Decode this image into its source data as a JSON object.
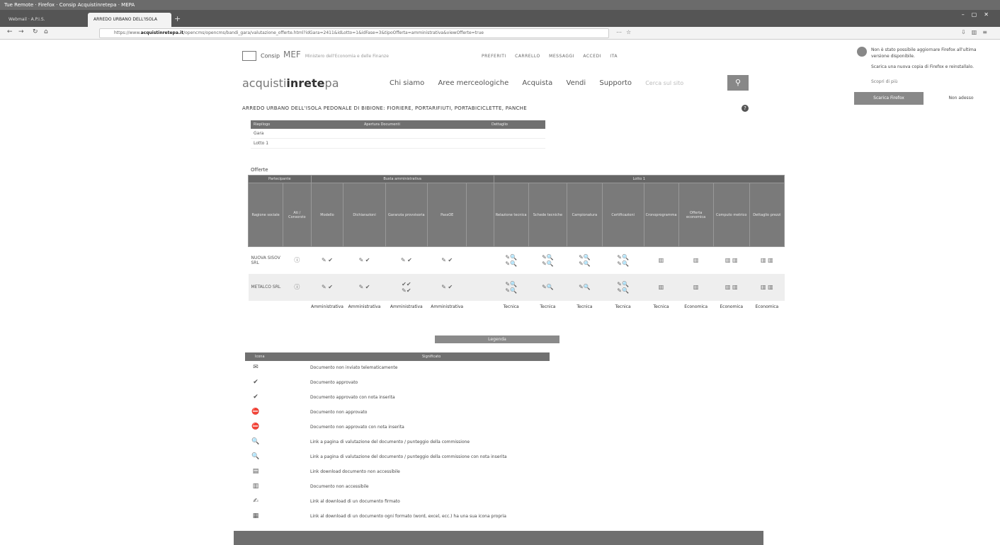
{
  "browser": {
    "window_title": "Tue Remote · Firefox · Consip Acquistinretepa · MEPA",
    "tabs": [
      {
        "label": "Webmail · A.P.I.S."
      },
      {
        "label": "ARREDO URBANO DELL'ISOLA P"
      }
    ],
    "url_prefix": "https://www.",
    "url_domain": "acquistinretepa.it",
    "url_rest": "/opencms/opencms/bandi_gara/valutazione_offerte.html?idGara=2411&idLotto=1&idFase=3&tipoOfferta=amministrativa&viewOfferte=true",
    "tab_close": "×",
    "new_tab": "+"
  },
  "header": {
    "consip": "Consip",
    "mef": "MEF",
    "mef_sub": "Ministero dell'Economia e delle Finanze",
    "top_links": [
      "PREFERITI",
      "CARRELLO",
      "MESSAGGI",
      "ACCEDI",
      "ITA"
    ],
    "brand_light": "acquisti",
    "brand_bold": "inrete",
    "brand_end": "pa",
    "nav": [
      "Chi siamo",
      "Aree merceologiche",
      "Acquista",
      "Vendi",
      "Supporto"
    ],
    "search_placeholder": "Cerca sul sito",
    "help": "?"
  },
  "page_title": "ARREDO URBANO DELL'ISOLA PEDONALE DI BIBIONE: FIORIERE, PORTARIFIUTI, PORTABICICLETTE, PANCHE",
  "lot_table": {
    "headers": [
      "Riepilogo",
      "Apertura Documenti",
      "Dettaglio"
    ],
    "rows": [
      "Gara",
      "Lotto 1"
    ]
  },
  "offers": {
    "label": "Offerte",
    "groups": [
      "Partecipante",
      "Busta amministrativa",
      "Lotto 1"
    ],
    "columns": [
      "Ragione sociale",
      "Ati / Consorzio",
      "Modello",
      "Dichiarazioni",
      "Garanzia provvisoria",
      "PassOE",
      "Relazione tecnica",
      "Schede tecniche",
      "Campionatura",
      "Certificazioni",
      "Cronoprogramma",
      "Offerta economica",
      "Computo metrico",
      "Dettaglio prezzi"
    ],
    "rows": [
      {
        "name": "NUOVA SISOV SRL"
      },
      {
        "name": "METALCO SRL"
      }
    ],
    "footer": [
      "Amministrativa",
      "Amministrativa",
      "Amministrativa",
      "Amministrativa",
      "Tecnica",
      "Tecnica",
      "Tecnica",
      "Tecnica",
      "Tecnica",
      "Economica",
      "Economica",
      "Economica"
    ]
  },
  "legend": {
    "title": "Legenda",
    "headers": [
      "Icona",
      "Significato"
    ],
    "items": [
      {
        "icon": "envelope-icon",
        "glyph": "✉",
        "text": "Documento non inviato telematicamente"
      },
      {
        "icon": "approved-icon",
        "glyph": "✔",
        "text": "Documento approvato"
      },
      {
        "icon": "approved-note-icon",
        "glyph": "✔",
        "text": "Documento approvato con nota inserita"
      },
      {
        "icon": "rejected-icon",
        "glyph": "⛔",
        "text": "Documento non approvato"
      },
      {
        "icon": "rejected-note-icon",
        "glyph": "⛔",
        "text": "Documento non approvato con nota inserita"
      },
      {
        "icon": "magnifier-icon",
        "glyph": "🔍",
        "text": "Link a pagina di valutazione del documento / punteggio della commissione"
      },
      {
        "icon": "magnifier-note-icon",
        "glyph": "🔍",
        "text": "Link a pagina di valutazione del documento / punteggio della commissione con nota inserita"
      },
      {
        "icon": "download-disabled-icon",
        "glyph": "▤",
        "text": "Link download documento non accessibile"
      },
      {
        "icon": "doc-disabled-icon",
        "glyph": "▥",
        "text": "Documento non accessibile"
      },
      {
        "icon": "signed-doc-icon",
        "glyph": "✍",
        "text": "Link al download di un documento firmato"
      },
      {
        "icon": "generic-doc-icon",
        "glyph": "▦",
        "text": "Link al download di un documento ogni formato (word, excel, ecc.) ha una sua icona propria"
      }
    ]
  },
  "notification": {
    "text1": "Non è stato possibile aggiornare Firefox all'ultima versione disponibile.",
    "text2": "Scarica una nuova copia di Firefox e reinstallalo.",
    "link": "Scopri di più",
    "btn_primary": "Scarica Firefox",
    "btn_secondary": "Non adesso"
  }
}
